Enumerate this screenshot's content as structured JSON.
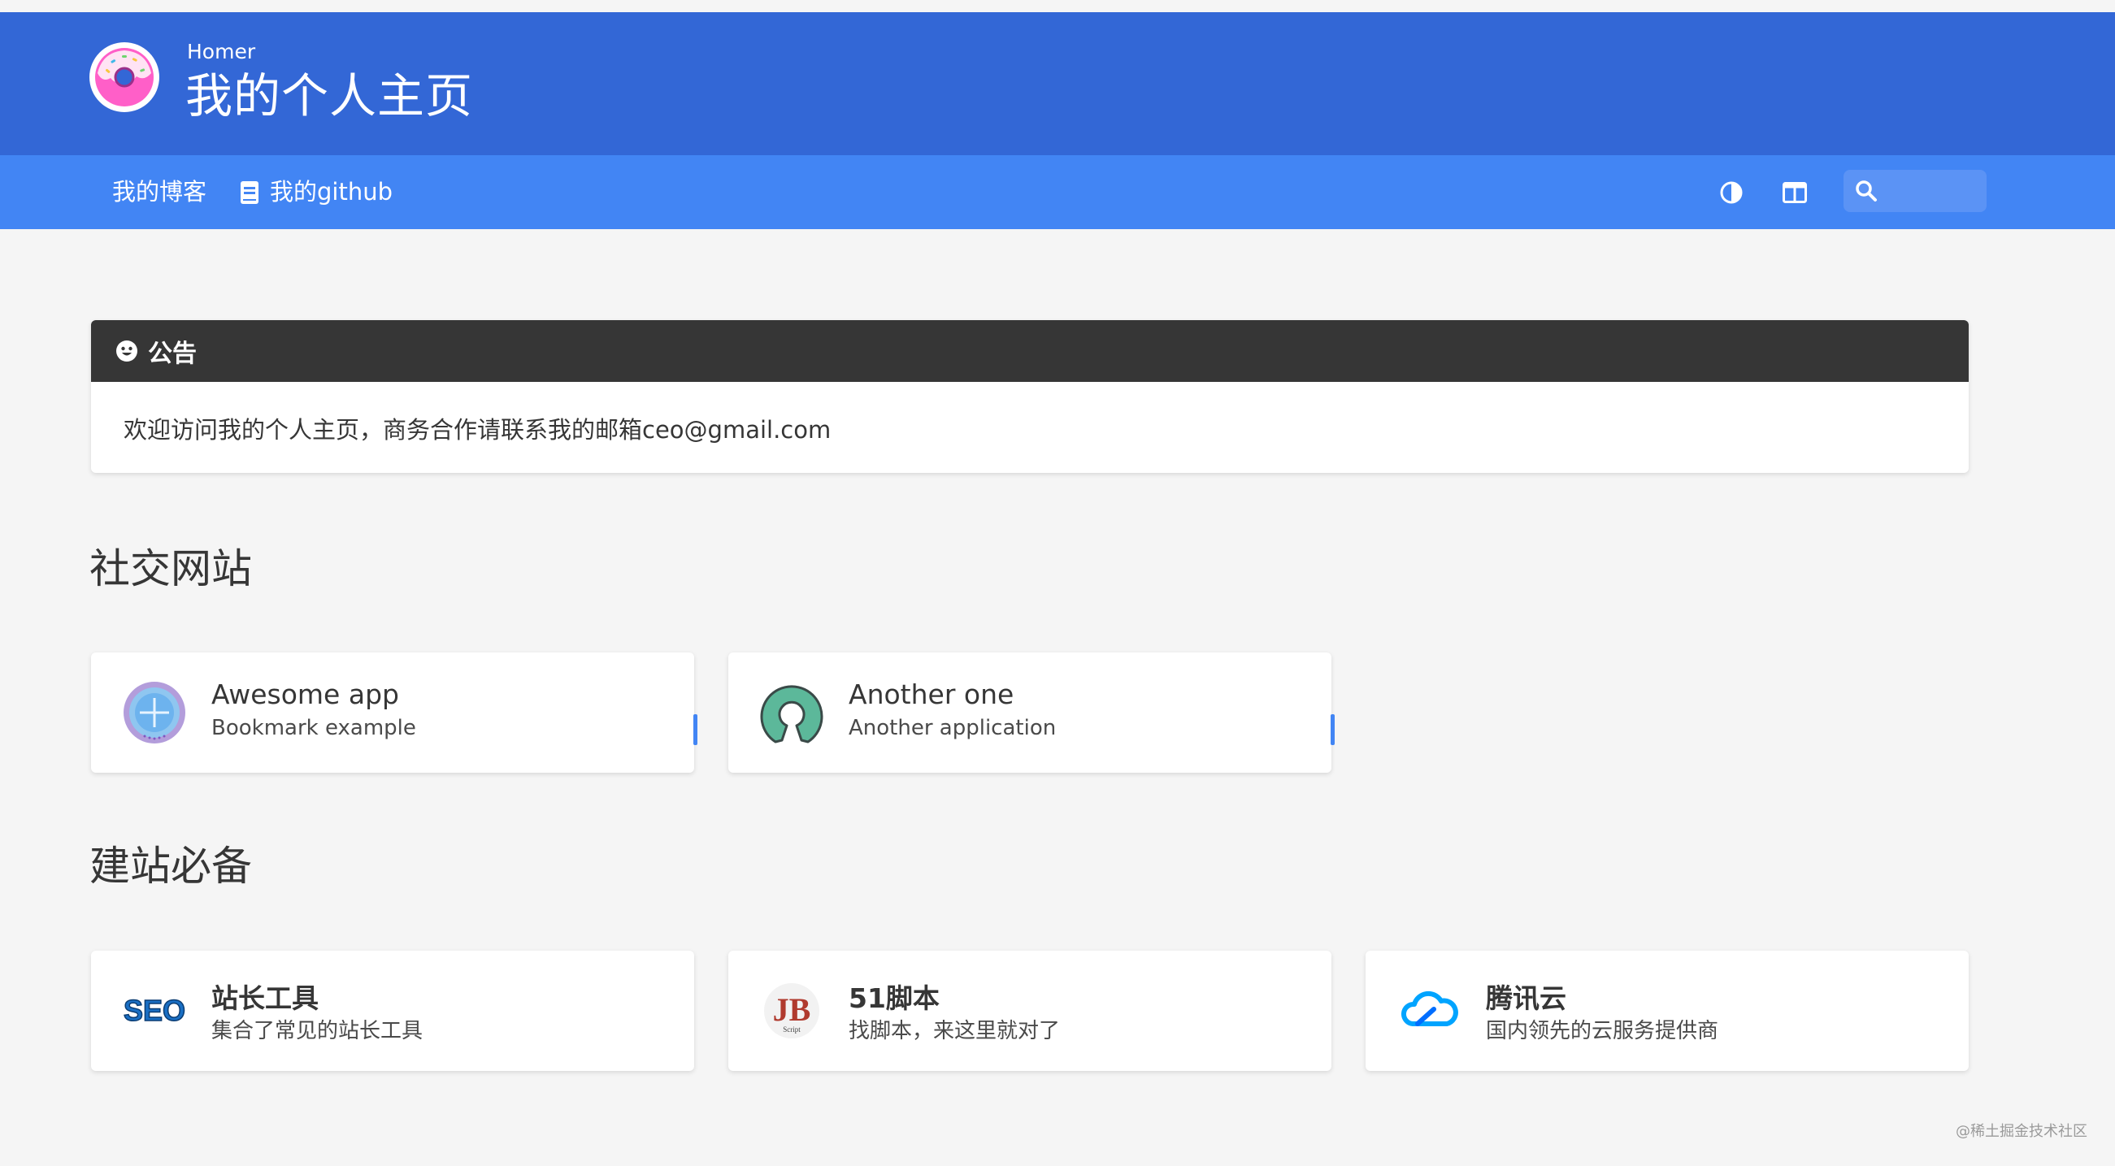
{
  "header": {
    "subtitle": "Homer",
    "title": "我的个人主页"
  },
  "navbar": {
    "links": [
      {
        "label": "我的博客"
      },
      {
        "label": "我的github",
        "icon": "book-icon"
      }
    ],
    "search": {
      "value": "",
      "placeholder": ""
    }
  },
  "message": {
    "title": "公告",
    "icon": "smile-icon",
    "content": "欢迎访问我的个人主页，商务合作请联系我的邮箱ceo@gmail.com"
  },
  "groups": [
    {
      "name": "社交网站",
      "items": [
        {
          "name": "Awesome app",
          "subtitle": "Bookmark example",
          "icon": "plus-circle-icon"
        },
        {
          "name": "Another one",
          "subtitle": "Another application",
          "icon": "open-source-icon"
        }
      ]
    },
    {
      "name": "建站必备",
      "items": [
        {
          "name": "站长工具",
          "subtitle": "集合了常见的站长工具",
          "icon": "seo-logo",
          "logo_text": "SEO"
        },
        {
          "name": "51脚本",
          "subtitle": "找脚本，来这里就对了",
          "icon": "jb-script-logo",
          "logo_text": "JB",
          "logo_caption": "Script"
        },
        {
          "name": "腾讯云",
          "subtitle": "国内领先的云服务提供商",
          "icon": "tencent-cloud-logo"
        }
      ]
    }
  ],
  "watermark": "@稀土掘金技术社区",
  "colors": {
    "header": "#3367d6",
    "navbar": "#4285f4",
    "notice_header": "#363636",
    "accent": "#4285f4"
  }
}
